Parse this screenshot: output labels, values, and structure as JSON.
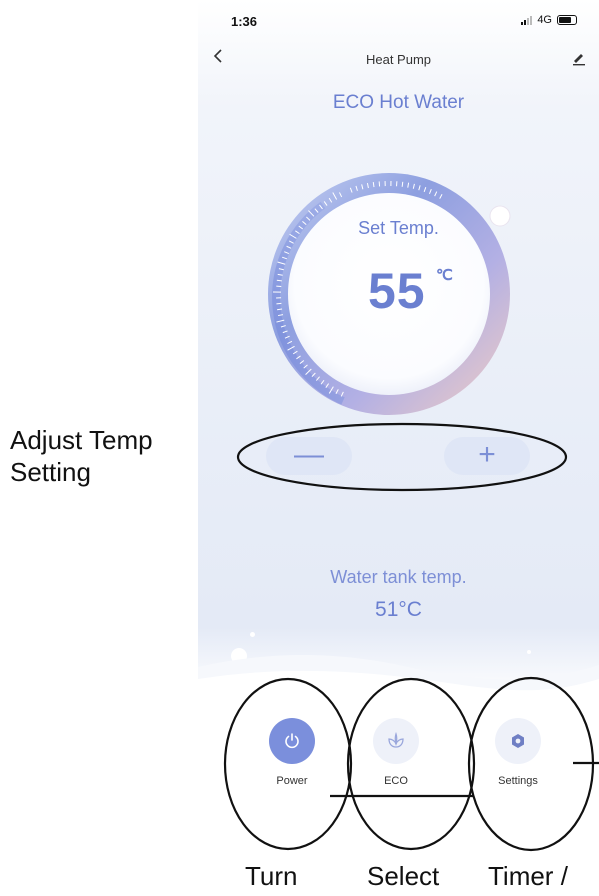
{
  "status_bar": {
    "time": "1:36",
    "network": "4G"
  },
  "header": {
    "back_icon": "chevron-left-icon",
    "title": "Heat Pump",
    "edit_icon": "pencil-icon"
  },
  "mode_label": "ECO Hot Water",
  "set_temp": {
    "label": "Set Temp.",
    "value": "55",
    "unit": "℃"
  },
  "temp_controls": {
    "minus_label": "—",
    "plus_label": "+"
  },
  "water_tank": {
    "label": "Water tank temp.",
    "value": "51°C"
  },
  "controls": [
    {
      "label": "Power",
      "icon": "power-icon",
      "active": true
    },
    {
      "label": "ECO",
      "icon": "leaf-icon",
      "active": false
    },
    {
      "label": "Settings",
      "icon": "gear-icon",
      "active": false
    }
  ],
  "annotations": {
    "adjust_line1": "Adjust Temp",
    "adjust_line2": "Setting",
    "turn": "Turn",
    "select": "Select",
    "timer": "Timer /"
  },
  "colors": {
    "accent": "#7b8fdc",
    "text_accent": "#6a7fd0",
    "button_bg": "#dfe6f6"
  }
}
